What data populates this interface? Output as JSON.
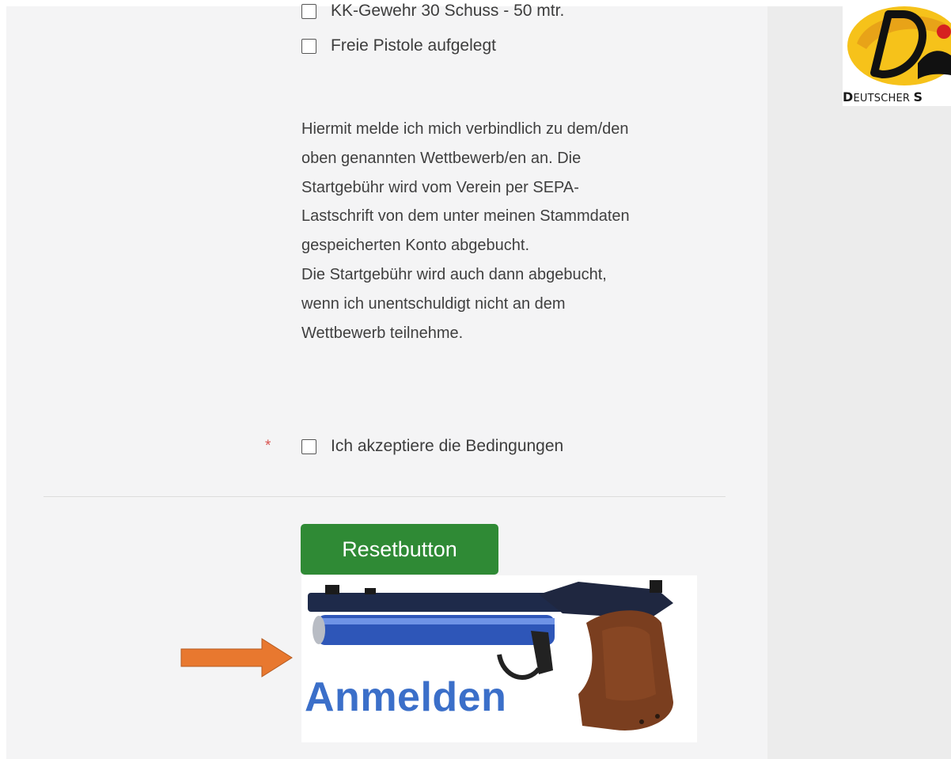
{
  "sidebar": {
    "logo_text": "DEUTSCHER S",
    "logo_first_letter": "D",
    "logo_rest": "EUTSCHER",
    "logo_s": "S"
  },
  "form": {
    "checkbox_top_label": "KK-Gewehr 30 Schuss - 50 mtr.",
    "checkbox_pistol_label": "Freie Pistole aufgelegt",
    "terms_lines": [
      "Hiermit melde ich mich verbindlich zu dem/den",
      "oben genannten Wettbewerb/en an. Die",
      "Startgebühr wird vom Verein per SEPA-",
      "Lastschrift von dem unter meinen Stammdaten",
      "gespeicherten Konto abgebucht.",
      "Die Startgebühr wird auch dann abgebucht,",
      "wenn ich unentschuldigt nicht an dem",
      "Wettbewerb teilnehme."
    ],
    "required_marker": "*",
    "accept_label": "Ich akzeptiere die Bedingungen",
    "reset_label": "Resetbutton",
    "submit_image_text": "Anmelden"
  },
  "colors": {
    "reset_button": "#2f8a35",
    "anmelden_text": "#3b6fc9",
    "arrow": "#e8782f",
    "required": "#d9534f"
  }
}
